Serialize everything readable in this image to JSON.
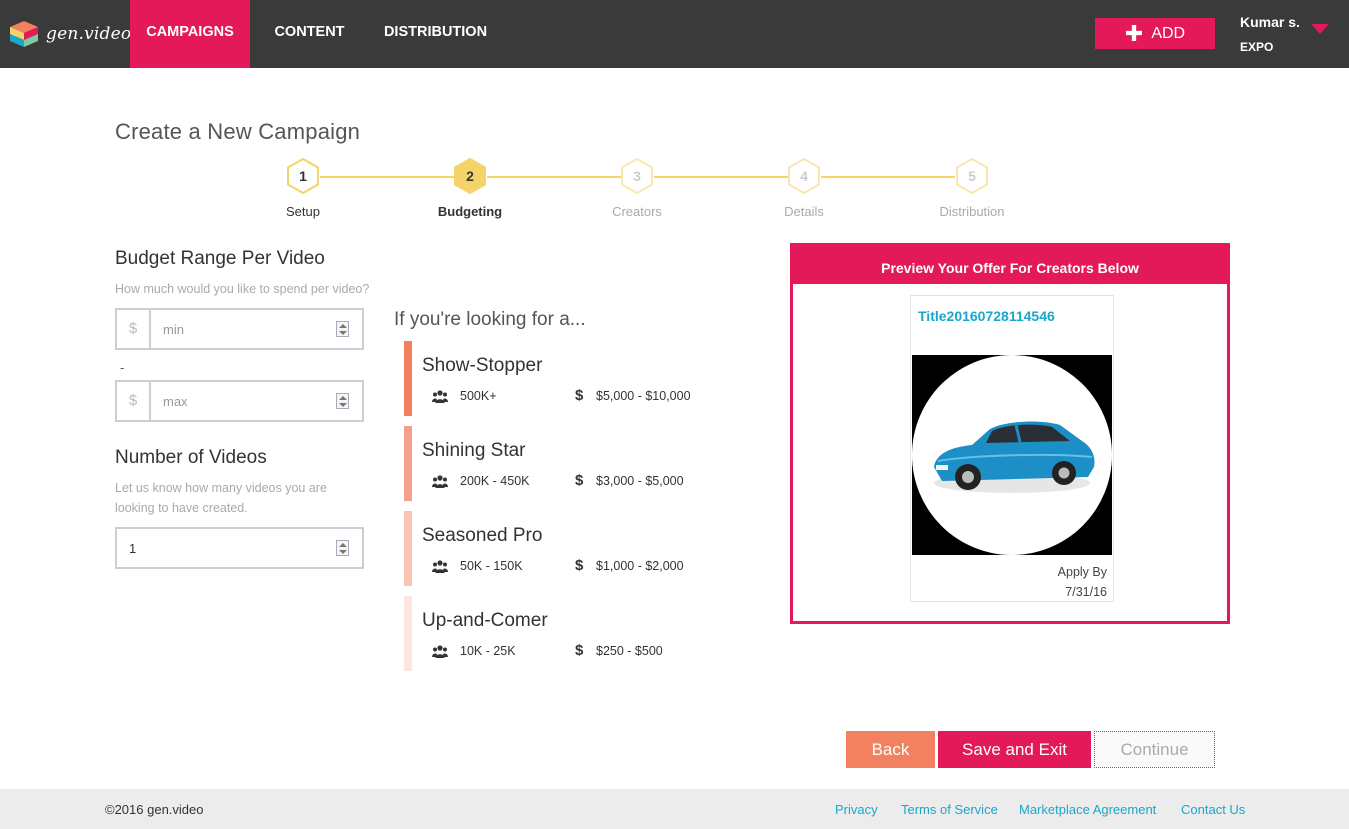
{
  "brand": {
    "name": "gen.video",
    "accent": "#e3195a"
  },
  "nav": {
    "campaigns": "CAMPAIGNS",
    "content": "CONTENT",
    "distribution": "DISTRIBUTION",
    "add_label": "ADD",
    "add_icon": "plus-icon",
    "user_name": "Kumar s.",
    "user_org": "EXPO"
  },
  "page": {
    "title": "Create a New Campaign"
  },
  "steps": [
    {
      "num": "1",
      "label": "Setup",
      "state": "completed"
    },
    {
      "num": "2",
      "label": "Budgeting",
      "state": "current"
    },
    {
      "num": "3",
      "label": "Creators",
      "state": "upcoming"
    },
    {
      "num": "4",
      "label": "Details",
      "state": "upcoming"
    },
    {
      "num": "5",
      "label": "Distribution",
      "state": "upcoming"
    }
  ],
  "budget": {
    "title": "Budget Range Per Video",
    "help": "How much would you like to spend per video?",
    "currency": "$",
    "min_placeholder": "min",
    "separator": "-",
    "max_placeholder": "max"
  },
  "videos": {
    "title": "Number of Videos",
    "help_line1": "Let us know how many videos you are",
    "help_line2": "looking to have created.",
    "value": "1"
  },
  "tiers": {
    "title": "If you're looking for a...",
    "items": [
      {
        "name": "Show-Stopper",
        "audience": "500K+",
        "currency": "$",
        "price": "$5,000 - $10,000",
        "color": "#f2825f"
      },
      {
        "name": "Shining Star",
        "audience": "200K - 450K",
        "currency": "$",
        "price": "$3,000 - $5,000",
        "color": "#f5a08b"
      },
      {
        "name": "Seasoned Pro",
        "audience": "50K - 150K",
        "currency": "$",
        "price": "$1,000 - $2,000",
        "color": "#f9c4b6"
      },
      {
        "name": "Up-and-Comer",
        "audience": "10K - 25K",
        "currency": "$",
        "price": "$250 - $500",
        "color": "#fde6df"
      }
    ]
  },
  "preview": {
    "header": "Preview Your Offer For Creators Below",
    "card_title": "Title20160728114546",
    "apply_label": "Apply By",
    "apply_date": "7/31/16"
  },
  "actions": {
    "back": "Back",
    "save": "Save and Exit",
    "continue": "Continue"
  },
  "footer": {
    "copyright": "©2016 gen.video",
    "privacy": "Privacy",
    "terms": "Terms of Service",
    "marketplace": "Marketplace Agreement",
    "contact": "Contact Us"
  }
}
